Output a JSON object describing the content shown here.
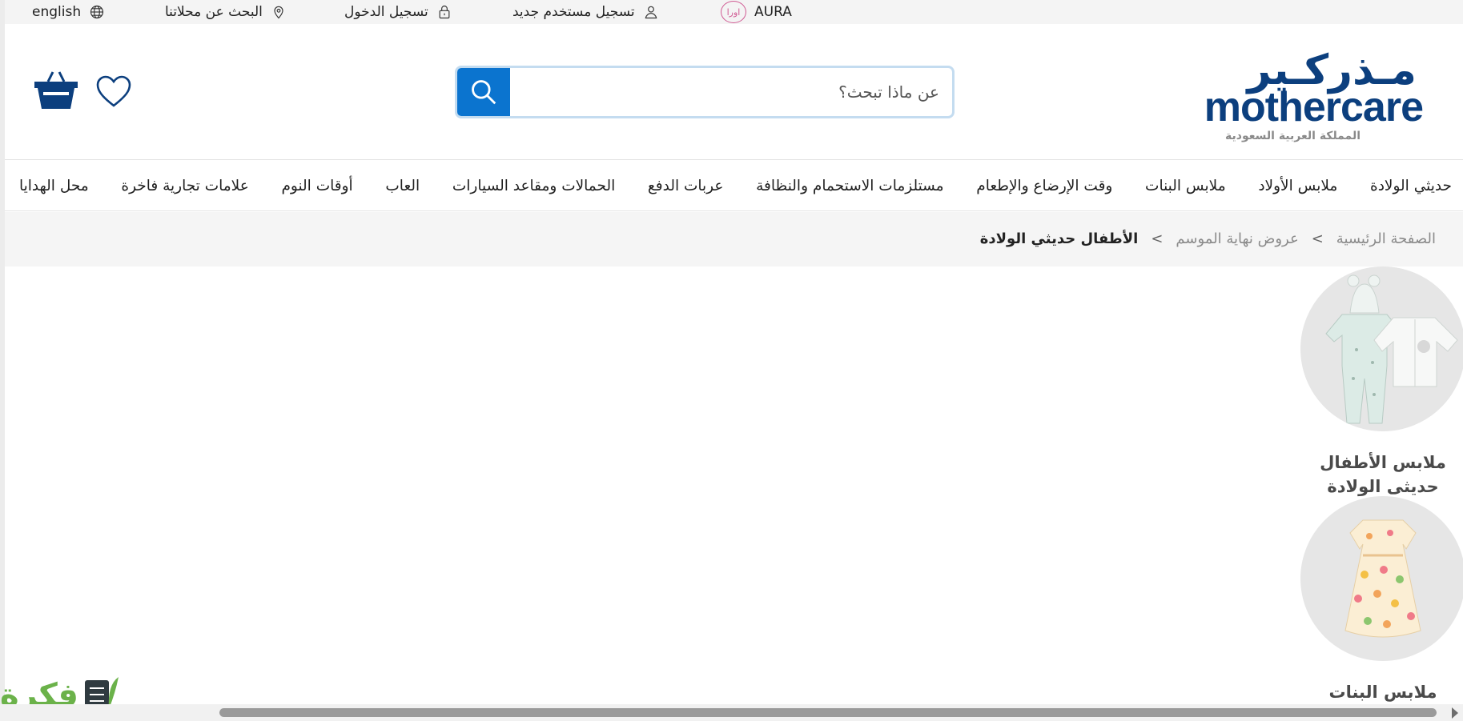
{
  "topbar": {
    "language": "english",
    "stores": "البحث عن محلاتنا",
    "login": "تسجيل الدخول",
    "register": "تسجيل مستخدم جديد",
    "aura": "AURA",
    "aura_logo": "اورا"
  },
  "header": {
    "logo_ar": "مـذركـير",
    "logo_en": "mothercare",
    "logo_sub": "المملكة العربية السعودية",
    "search_placeholder": "عن ماذا تبحث؟"
  },
  "nav": {
    "items": [
      "حديثي الولادة",
      "ملابس الأولاد",
      "ملابس البنات",
      "وقت الإرضاع والإطعام",
      "مستلزمات الاستحمام والنظافة",
      "عربات الدفع",
      "الحمالات ومقاعد السيارات",
      "العاب",
      "أوقات النوم",
      "علامات تجارية فاخرة",
      "محل الهدايا"
    ]
  },
  "breadcrumb": {
    "items": [
      "الصفحة الرئيسية",
      "عروض نهاية الموسم",
      "الأطفال حديثي الولادة"
    ],
    "separator": ">"
  },
  "categories": [
    {
      "label_line1": "ملابس الأطفال",
      "label_line2": "حديثى الولادة"
    },
    {
      "label_line1": "ملابس البنات",
      "label_line2": ""
    }
  ],
  "watermark": {
    "text": "فكرة"
  },
  "colors": {
    "brand": "#0c3f7e",
    "search_button": "#0b74cf",
    "search_border": "#c4dcf0",
    "aura": "#d05a93"
  }
}
